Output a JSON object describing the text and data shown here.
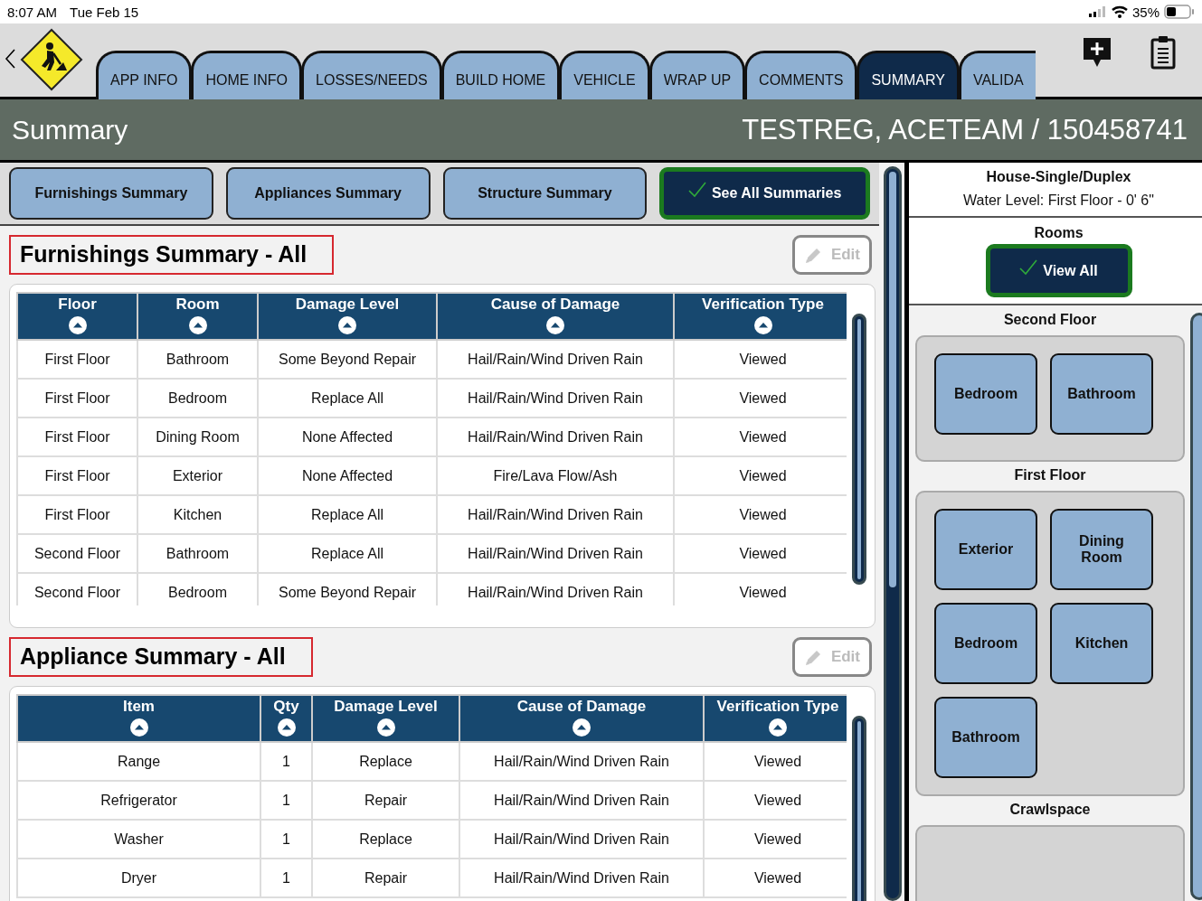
{
  "status_bar": {
    "time": "8:07 AM",
    "date": "Tue Feb 15",
    "battery": "35%"
  },
  "tabs": [
    {
      "label": "APP INFO",
      "selected": false
    },
    {
      "label": "HOME INFO",
      "selected": false
    },
    {
      "label": "LOSSES/NEEDS",
      "selected": false
    },
    {
      "label": "BUILD HOME",
      "selected": false
    },
    {
      "label": "VEHICLE",
      "selected": false
    },
    {
      "label": "WRAP UP",
      "selected": false
    },
    {
      "label": "COMMENTS",
      "selected": false
    },
    {
      "label": "SUMMARY",
      "selected": true
    },
    {
      "label": "VALIDA",
      "selected": false
    }
  ],
  "title_bar": {
    "title": "Summary",
    "record": "TESTREG, ACETEAM / 150458741"
  },
  "summary_buttons": [
    {
      "label": "Furnishings Summary",
      "selected": false
    },
    {
      "label": "Appliances Summary",
      "selected": false
    },
    {
      "label": "Structure Summary",
      "selected": false
    },
    {
      "label": "See All Summaries",
      "selected": true
    }
  ],
  "sections": [
    {
      "kind": "furnishings",
      "title": "Furnishings Summary - All",
      "edit": "Edit",
      "columns": [
        "Floor",
        "Room",
        "Damage Level",
        "Cause of Damage",
        "Verification Type"
      ],
      "rows": [
        [
          "First Floor",
          "Bathroom",
          "Some Beyond Repair",
          "Hail/Rain/Wind Driven Rain",
          "Viewed"
        ],
        [
          "First Floor",
          "Bedroom",
          "Replace All",
          "Hail/Rain/Wind Driven Rain",
          "Viewed"
        ],
        [
          "First Floor",
          "Dining Room",
          "None Affected",
          "Hail/Rain/Wind Driven Rain",
          "Viewed"
        ],
        [
          "First Floor",
          "Exterior",
          "None Affected",
          "Fire/Lava Flow/Ash",
          "Viewed"
        ],
        [
          "First Floor",
          "Kitchen",
          "Replace All",
          "Hail/Rain/Wind Driven Rain",
          "Viewed"
        ],
        [
          "Second Floor",
          "Bathroom",
          "Replace All",
          "Hail/Rain/Wind Driven Rain",
          "Viewed"
        ],
        [
          "Second Floor",
          "Bedroom",
          "Some Beyond Repair",
          "Hail/Rain/Wind Driven Rain",
          "Viewed"
        ]
      ]
    },
    {
      "kind": "appliances",
      "title": "Appliance Summary - All",
      "edit": "Edit",
      "columns": [
        "Item",
        "Qty",
        "Damage Level",
        "Cause of Damage",
        "Verification Type"
      ],
      "rows": [
        [
          "Range",
          "1",
          "Replace",
          "Hail/Rain/Wind Driven Rain",
          "Viewed"
        ],
        [
          "Refrigerator",
          "1",
          "Repair",
          "Hail/Rain/Wind Driven Rain",
          "Viewed"
        ],
        [
          "Washer",
          "1",
          "Replace",
          "Hail/Rain/Wind Driven Rain",
          "Viewed"
        ],
        [
          "Dryer",
          "1",
          "Repair",
          "Hail/Rain/Wind Driven Rain",
          "Viewed"
        ]
      ]
    }
  ],
  "side_panel": {
    "home_type": "House-Single/Duplex",
    "water_level": "Water Level: First Floor - 0' 6\"",
    "rooms_label": "Rooms",
    "view_all": {
      "label": "View All",
      "selected": true
    },
    "floors": [
      {
        "name": "Second Floor",
        "rooms": [
          "Bedroom",
          "Bathroom"
        ]
      },
      {
        "name": "First Floor",
        "rooms": [
          "Exterior",
          "Dining Room",
          "Bedroom",
          "Kitchen",
          "Bathroom"
        ]
      },
      {
        "name": "Crawlspace"
      }
    ]
  }
}
